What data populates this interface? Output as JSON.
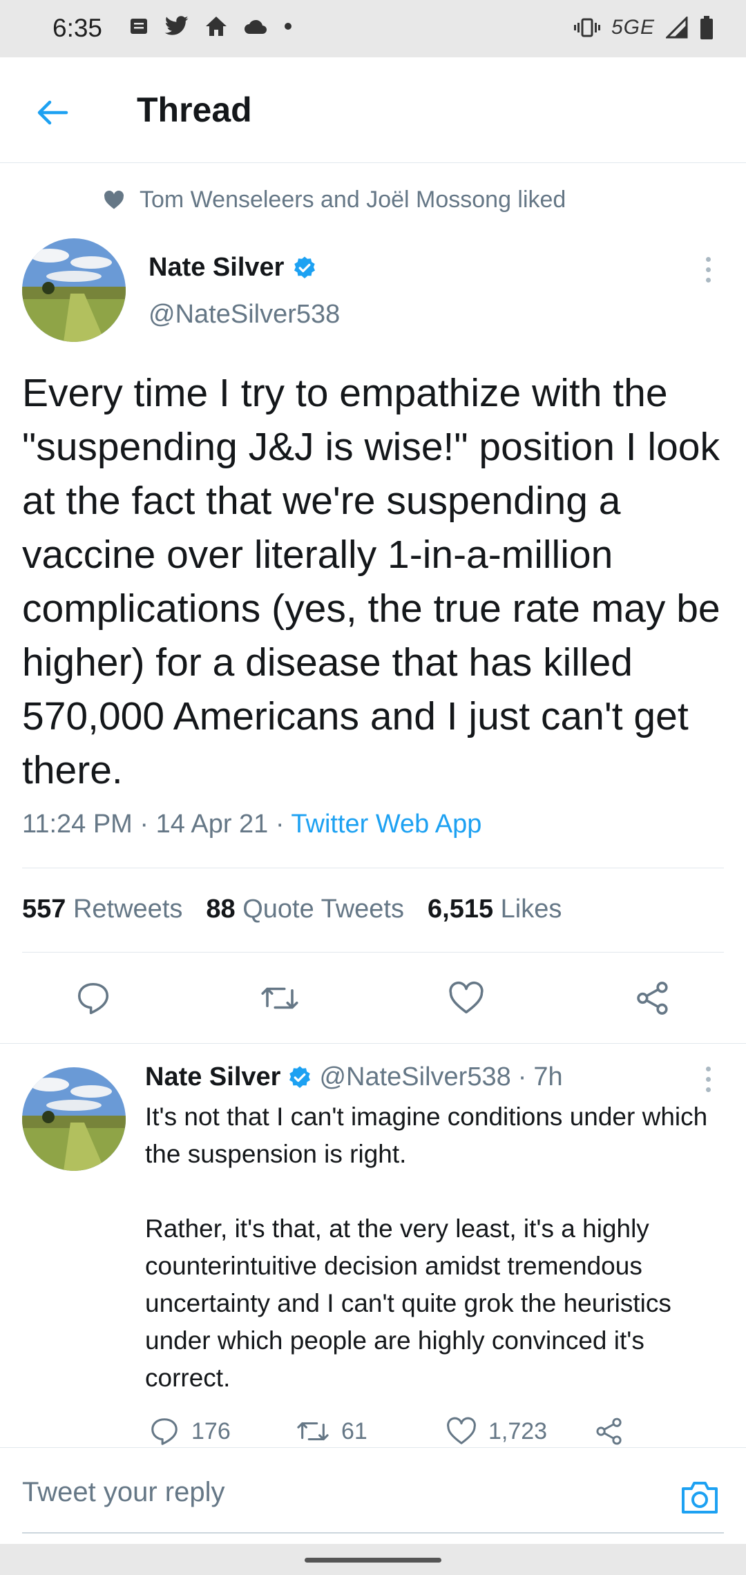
{
  "status_bar": {
    "time": "6:35",
    "network": "5GE",
    "icons_left": [
      "notes-icon",
      "twitter-icon",
      "home-icon",
      "cloud-icon",
      "dot-icon"
    ],
    "icons_right": [
      "vibrate-icon",
      "signal-icon",
      "battery-icon"
    ]
  },
  "header": {
    "title": "Thread"
  },
  "social_context": {
    "text": "Tom Wenseleers and Joël Mossong liked"
  },
  "main_tweet": {
    "author_name": "Nate Silver",
    "handle": "@NateSilver538",
    "verified": true,
    "text": "Every time I try to empathize with the \"suspending J&J is wise!\" position I look at the fact that we're suspending a vaccine over literally 1-in-a-million complications (yes, the true rate may be higher) for a disease that has killed 570,000 Americans and I just can't get there.",
    "time": "11:24 PM",
    "date": "14 Apr 21",
    "source": "Twitter Web App",
    "stats": {
      "retweets_count": "557",
      "retweets_label": "Retweets",
      "quotes_count": "88",
      "quotes_label": "Quote Tweets",
      "likes_count": "6,515",
      "likes_label": "Likes"
    }
  },
  "reply_tweet": {
    "author_name": "Nate Silver",
    "handle": "@NateSilver538",
    "age": "7h",
    "verified": true,
    "text": "It's not that I can't imagine conditions under which the suspension is right.\n\nRather, it's that, at the very least, it's a highly counterintuitive decision amidst tremendous uncertainty and I can't quite grok the heuristics under which people are highly convinced it's correct.",
    "replies": "176",
    "retweets": "61",
    "likes": "1,723"
  },
  "composer": {
    "placeholder": "Tweet your reply"
  },
  "colors": {
    "accent": "#1da1f2",
    "text_secondary": "#657786",
    "text_primary": "#14171a"
  }
}
